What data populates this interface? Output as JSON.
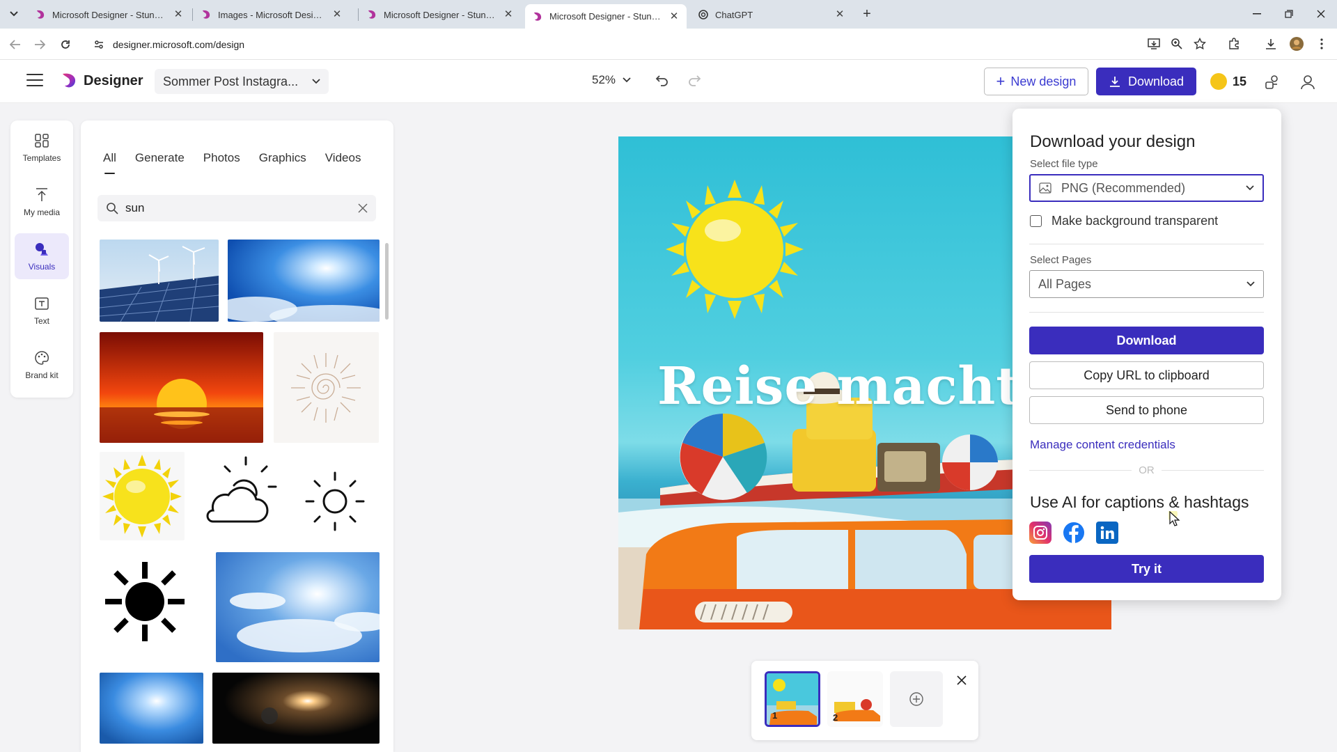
{
  "browser": {
    "tabs": [
      {
        "title": "Microsoft Designer - Stunning designs in a flash",
        "active": false
      },
      {
        "title": "Images - Microsoft Designer",
        "active": false
      },
      {
        "title": "Microsoft Designer - Stunning designs in a flash",
        "active": false
      },
      {
        "title": "Microsoft Designer - Stunning designs in a flash",
        "active": true
      },
      {
        "title": "ChatGPT",
        "active": false
      }
    ],
    "url": "designer.microsoft.com/design"
  },
  "header": {
    "app_name": "Designer",
    "doc_name": "Sommer Post Instagra...",
    "zoom": "52%",
    "new_design_label": "New design",
    "download_label": "Download",
    "coins": "15"
  },
  "rail": {
    "items": [
      {
        "label": "Templates",
        "icon": "templates-icon"
      },
      {
        "label": "My media",
        "icon": "upload-icon"
      },
      {
        "label": "Visuals",
        "icon": "visuals-icon"
      },
      {
        "label": "Text",
        "icon": "text-icon"
      },
      {
        "label": "Brand kit",
        "icon": "palette-icon"
      }
    ],
    "active": "Visuals"
  },
  "panel": {
    "tabs": [
      "All",
      "Generate",
      "Photos",
      "Graphics",
      "Videos"
    ],
    "active_tab": "All",
    "search_value": "sun"
  },
  "canvas": {
    "title_text": "Reise macht Spaß"
  },
  "pages": {
    "items": [
      {
        "num": "1"
      },
      {
        "num": "2"
      }
    ],
    "selected": "1"
  },
  "download_panel": {
    "title": "Download your design",
    "file_type_label": "Select file type",
    "file_type_value": "PNG (Recommended)",
    "transparent_label": "Make background transparent",
    "pages_label": "Select Pages",
    "pages_value": "All Pages",
    "download_button": "Download",
    "copy_url_button": "Copy URL to clipboard",
    "send_phone_button": "Send to phone",
    "credentials_link": "Manage content credentials",
    "or_text": "OR",
    "ai_title": "Use AI for captions & hashtags",
    "try_button": "Try it",
    "colors": {
      "accent": "#3a2dbd"
    }
  }
}
